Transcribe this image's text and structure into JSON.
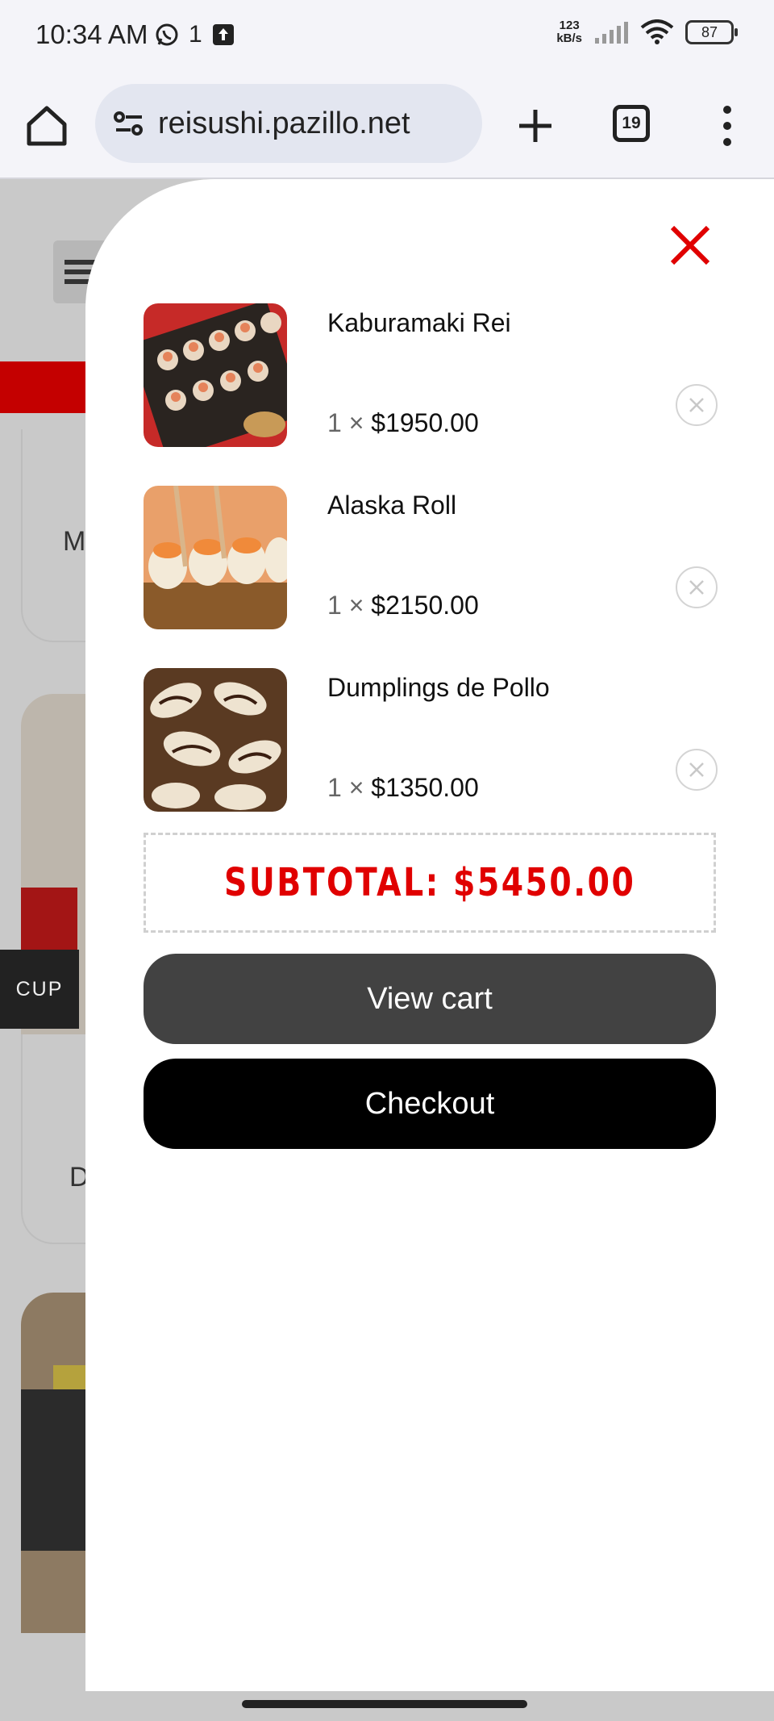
{
  "status_bar": {
    "time": "10:34 AM",
    "extra": "1",
    "network_speed_top": "123",
    "network_speed_bottom": "kB/s",
    "battery": "87"
  },
  "browser": {
    "url": "reisushi.pazillo.net",
    "tab_count": "19"
  },
  "background_page": {
    "letter_1": "M",
    "letter_2": "D",
    "cup_label": "CUP"
  },
  "cart": {
    "items": [
      {
        "name": "Kaburamaki Rei",
        "qty": "1",
        "times": "×",
        "price": "$1950.00",
        "image_icon": "sushi-photo"
      },
      {
        "name": "Alaska Roll",
        "qty": "1",
        "times": "×",
        "price": "$2150.00",
        "image_icon": "roll-photo"
      },
      {
        "name": "Dumplings de Pollo",
        "qty": "1",
        "times": "×",
        "price": "$1350.00",
        "image_icon": "dumplings-photo"
      }
    ],
    "subtotal_label": "SUBTOTAL: $5450.00",
    "view_cart_label": "View cart",
    "checkout_label": "Checkout"
  },
  "colors": {
    "accent_red": "#e00000",
    "dark_button": "#424242",
    "checkout_button": "#000000"
  }
}
